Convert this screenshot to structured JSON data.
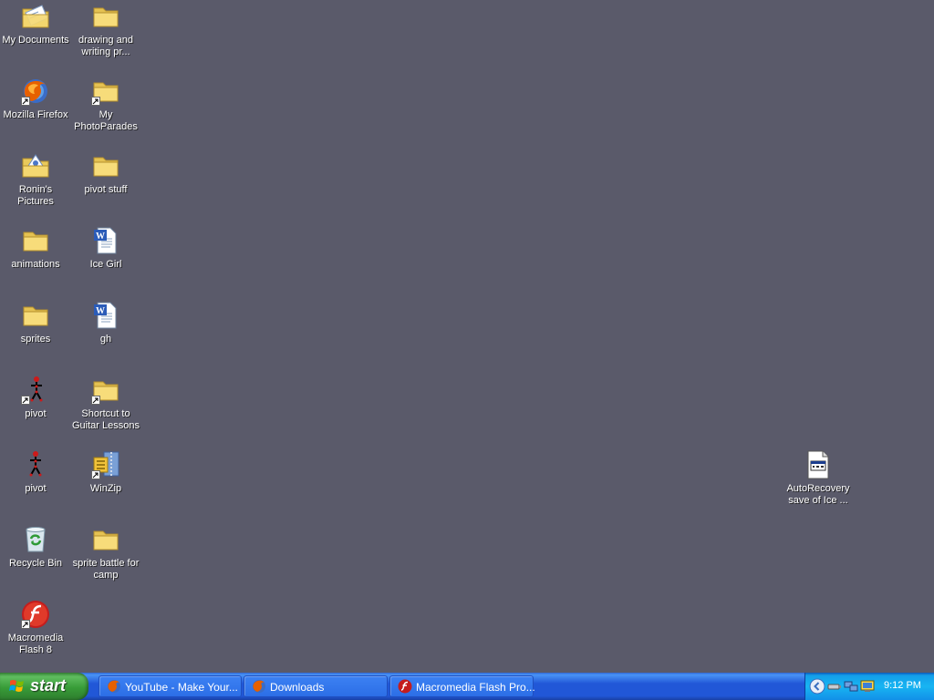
{
  "desktop": {
    "background_color": "#5a5a6a",
    "icons": [
      {
        "label": "My Documents",
        "icon": "my-documents-folder-icon"
      },
      {
        "label": "drawing and writing pr...",
        "icon": "folder-icon"
      },
      {
        "label": "Mozilla Firefox",
        "icon": "firefox-icon",
        "shortcut": true
      },
      {
        "label": "My PhotoParades",
        "icon": "folder-icon",
        "shortcut": true
      },
      {
        "label": "Ronin's Pictures",
        "icon": "pictures-folder-icon"
      },
      {
        "label": "pivot stuff",
        "icon": "folder-icon"
      },
      {
        "label": "animations",
        "icon": "folder-icon"
      },
      {
        "label": "Ice Girl",
        "icon": "word-document-icon"
      },
      {
        "label": "sprites",
        "icon": "folder-icon"
      },
      {
        "label": "gh",
        "icon": "word-document-icon"
      },
      {
        "label": "pivot",
        "icon": "pivot-stickman-icon",
        "shortcut": true
      },
      {
        "label": "Shortcut to Guitar Lessons",
        "icon": "folder-icon",
        "shortcut": true
      },
      {
        "label": "pivot",
        "icon": "pivot-stickman-icon"
      },
      {
        "label": "WinZip",
        "icon": "winzip-icon",
        "shortcut": true
      },
      {
        "label": "Recycle Bin",
        "icon": "recycle-bin-icon"
      },
      {
        "label": "sprite battle for camp",
        "icon": "folder-icon"
      },
      {
        "label": "Macromedia Flash 8",
        "icon": "flash-icon",
        "shortcut": true
      },
      {
        "label": "AutoRecovery save of Ice ...",
        "icon": "autorecovery-file-icon"
      }
    ]
  },
  "taskbar": {
    "start_label": "start",
    "tasks": [
      {
        "label": "YouTube - Make Your...",
        "icon": "firefox-icon"
      },
      {
        "label": "Downloads",
        "icon": "firefox-icon"
      },
      {
        "label": "Macromedia Flash Pro...",
        "icon": "flash-icon"
      }
    ],
    "tray": {
      "icons": [
        "show-hidden-icons-chevron-icon",
        "usb-device-icon",
        "network-icon",
        "display-monitor-icon"
      ],
      "clock": "9:12 PM"
    }
  }
}
